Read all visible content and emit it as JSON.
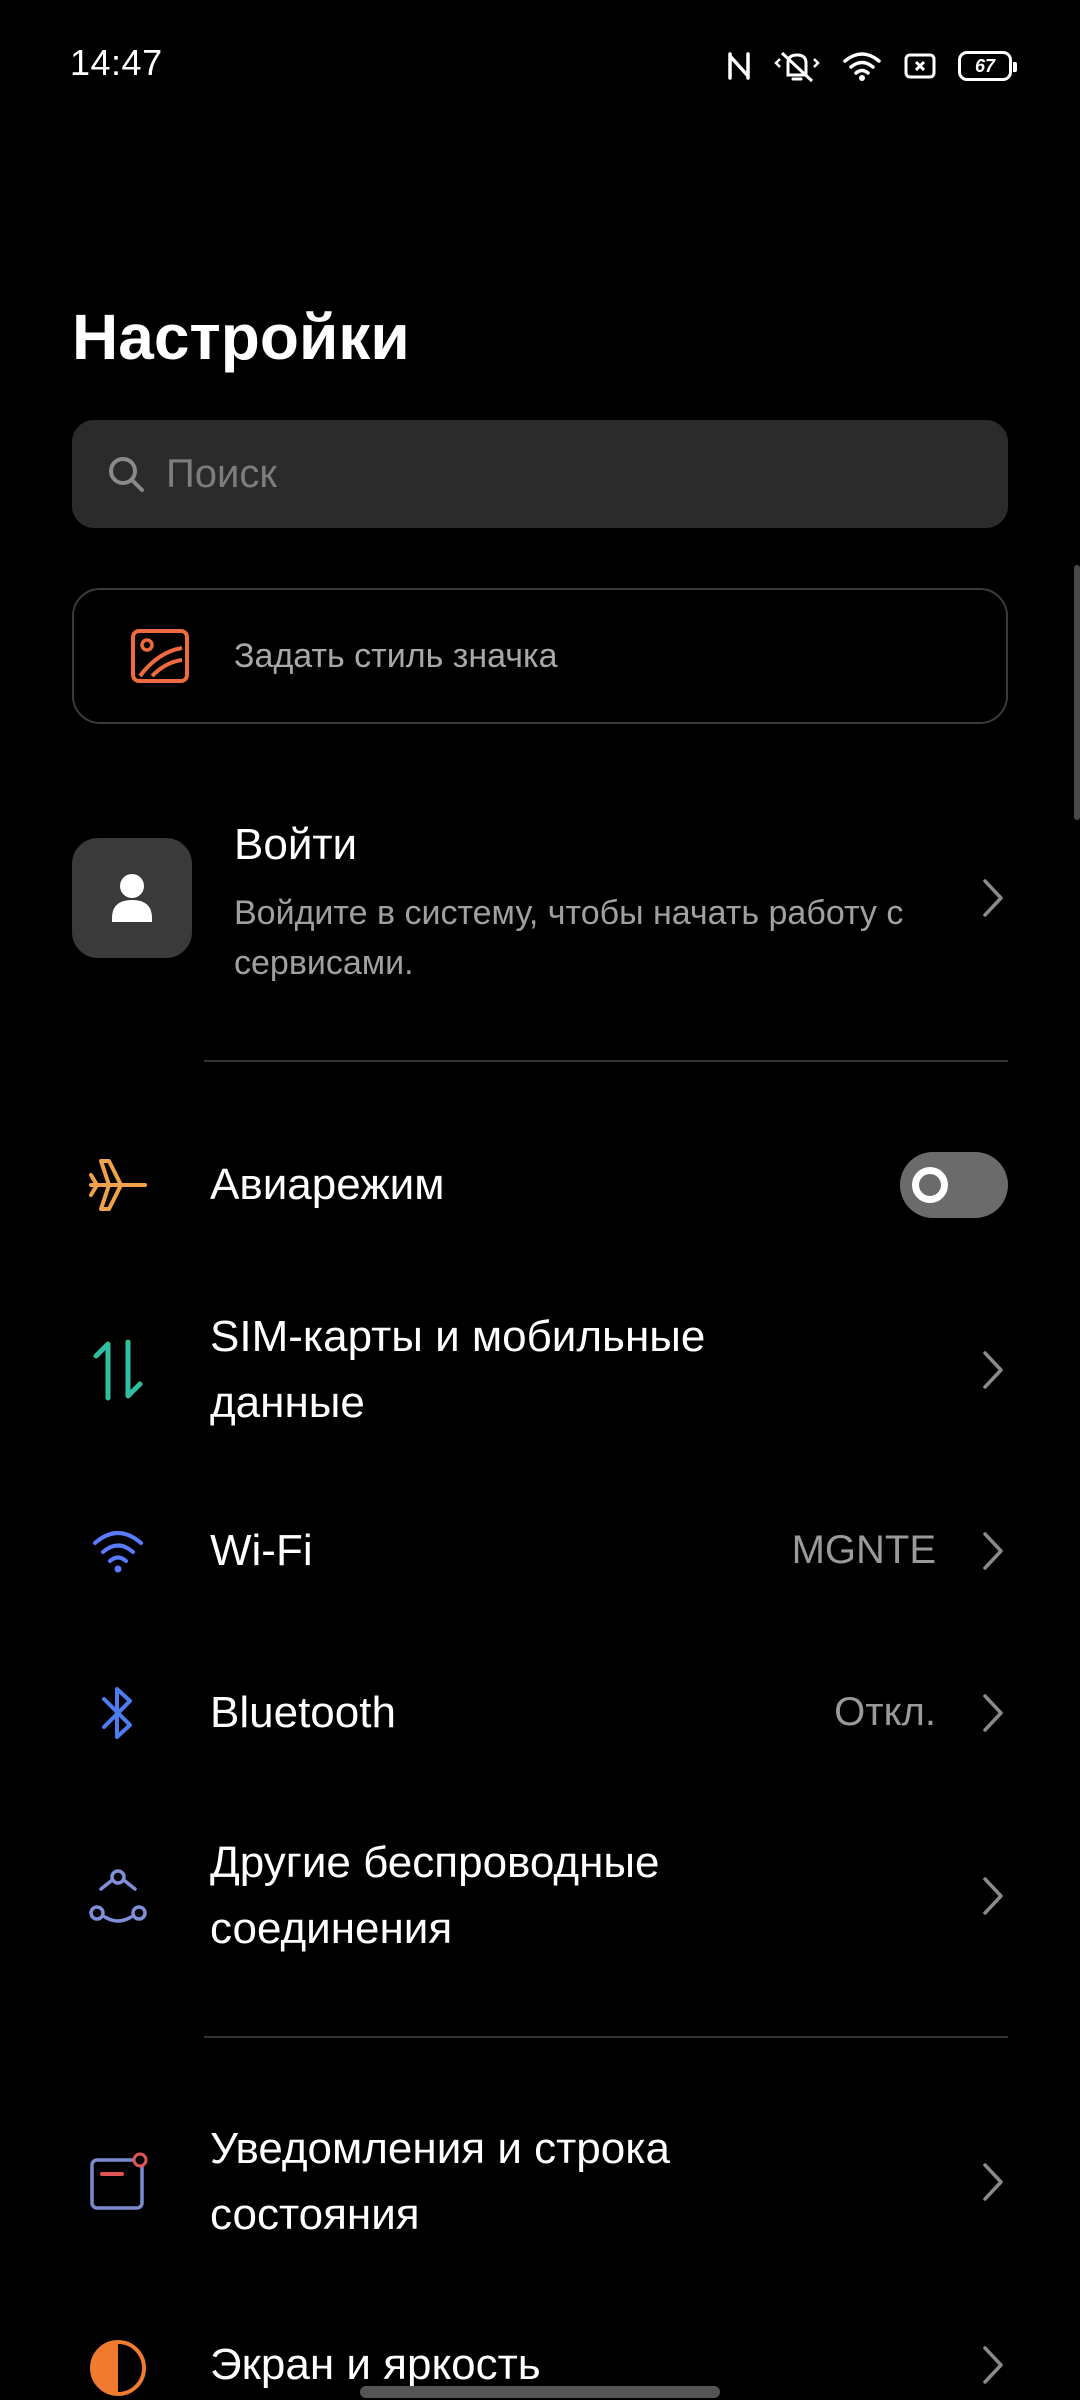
{
  "status_bar": {
    "time": "14:47",
    "icons": [
      "nfc-icon",
      "vibrate-icon",
      "wifi-icon",
      "screen-record-icon",
      "battery-icon"
    ],
    "battery_level": "67"
  },
  "header": {
    "title": "Настройки"
  },
  "search": {
    "placeholder": "Поиск"
  },
  "icon_style_card": {
    "label": "Задать стиль значка",
    "icon": "image-style-icon"
  },
  "account": {
    "title": "Войти",
    "subtitle": "Войдите в систему, чтобы начать работу с сервисами."
  },
  "settings": [
    {
      "label": "Авиарежим",
      "icon": "airplane-icon",
      "toggle": "off"
    },
    {
      "label": "SIM-карты и мобильные данные",
      "icon": "mobile-data-icon"
    },
    {
      "label": "Wi-Fi",
      "value": "MGNTE",
      "icon": "wifi-icon"
    },
    {
      "label": "Bluetooth",
      "value": "Откл.",
      "icon": "bluetooth-icon"
    },
    {
      "label": "Другие беспроводные соединения",
      "icon": "connections-icon"
    },
    {
      "label": "Уведомления и строка состояния",
      "icon": "notifications-icon"
    },
    {
      "label": "Экран и яркость",
      "icon": "display-brightness-icon"
    }
  ],
  "colors": {
    "background": "#000000",
    "search_bg": "#2b2b2b",
    "airplane": "#f0a24a",
    "mobile_data": "#2fbfa0",
    "wifi": "#5b7bff",
    "bluetooth": "#4c7cf0",
    "connections": "#8090d8",
    "notifications": "#7a8ccc",
    "brightness": "#f07a30",
    "icon_style": "#ef6a3c"
  }
}
